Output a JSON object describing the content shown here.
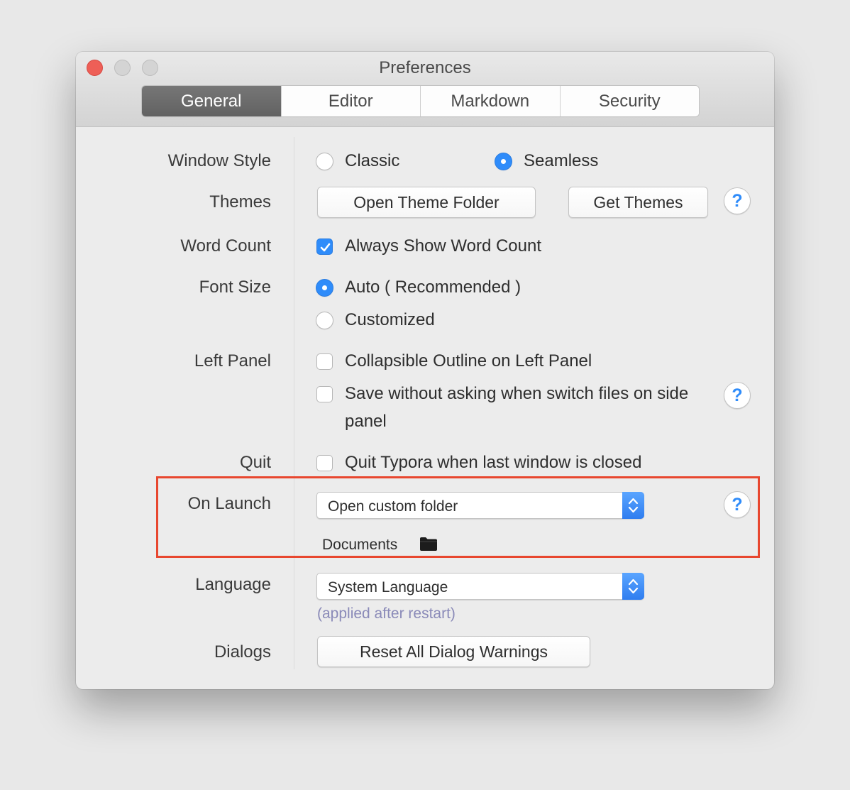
{
  "window": {
    "title": "Preferences"
  },
  "tabs": [
    {
      "label": "General",
      "active": true
    },
    {
      "label": "Editor",
      "active": false
    },
    {
      "label": "Markdown",
      "active": false
    },
    {
      "label": "Security",
      "active": false
    }
  ],
  "window_style": {
    "label": "Window Style",
    "options": [
      "Classic",
      "Seamless"
    ],
    "selected": "Seamless"
  },
  "themes": {
    "label": "Themes",
    "open_button": "Open Theme Folder",
    "get_button": "Get Themes"
  },
  "word_count": {
    "label": "Word Count",
    "option": "Always Show Word Count",
    "checked": true
  },
  "font_size": {
    "label": "Font Size",
    "options": [
      "Auto ( Recommended )",
      "Customized"
    ],
    "selected": "Auto ( Recommended )"
  },
  "left_panel": {
    "label": "Left Panel",
    "collapsible": "Collapsible Outline on Left Panel",
    "save_line1": "Save without asking when switch files on side",
    "save_line2": "panel"
  },
  "quit": {
    "label": "Quit",
    "option": "Quit Typora when last window is closed"
  },
  "on_launch": {
    "label": "On Launch",
    "selected": "Open custom folder",
    "folder": "Documents"
  },
  "language": {
    "label": "Language",
    "selected": "System Language",
    "hint": "(applied after restart)"
  },
  "dialogs": {
    "label": "Dialogs",
    "reset_button": "Reset All Dialog Warnings"
  },
  "help_glyph": "?",
  "colors": {
    "accent": "#2f8cfa",
    "highlight": "#e8472f",
    "close_light": "#ee5f57"
  }
}
